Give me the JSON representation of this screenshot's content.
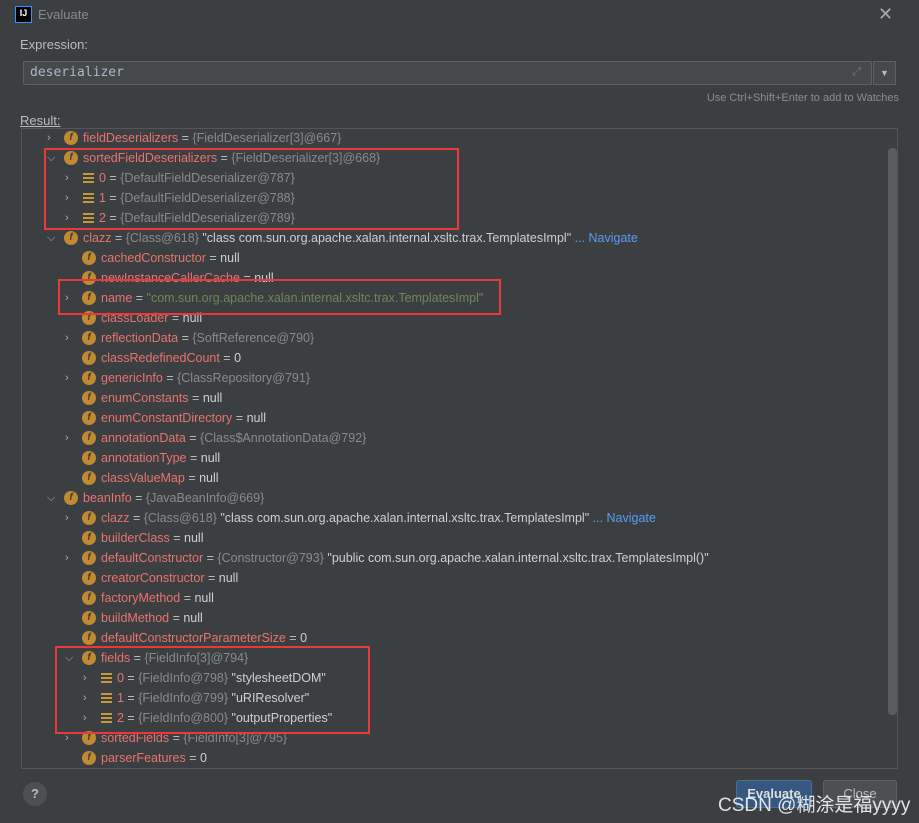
{
  "window": {
    "title": "Evaluate",
    "logo": "IJ",
    "close_icon": "close-icon"
  },
  "expression": {
    "label": "Expression:",
    "value": "deserializer",
    "hint": "Use Ctrl+Shift+Enter to add to Watches"
  },
  "result": {
    "label": "Result:"
  },
  "rows": [
    {
      "level": 0,
      "exp": "collapsed",
      "icon": "field",
      "name": "fieldDeserializers",
      "type": "{FieldDeserializer[3]@667}"
    },
    {
      "level": 0,
      "exp": "expanded",
      "icon": "field",
      "name": "sortedFieldDeserializers",
      "type": "{FieldDeserializer[3]@668}"
    },
    {
      "level": 1,
      "exp": "collapsed",
      "icon": "array",
      "name": "0",
      "type": "{DefaultFieldDeserializer@787}"
    },
    {
      "level": 1,
      "exp": "collapsed",
      "icon": "array",
      "name": "1",
      "type": "{DefaultFieldDeserializer@788}"
    },
    {
      "level": 1,
      "exp": "collapsed",
      "icon": "array",
      "name": "2",
      "type": "{DefaultFieldDeserializer@789}"
    },
    {
      "level": 0,
      "exp": "expanded",
      "icon": "field",
      "name": "clazz",
      "type": "{Class@618}",
      "str": "\"class com.sun.org.apache.xalan.internal.xsltc.trax.TemplatesImpl\"",
      "nav": "... Navigate"
    },
    {
      "level": 1,
      "exp": "none",
      "icon": "field",
      "name": "cachedConstructor",
      "plain": "null"
    },
    {
      "level": 1,
      "exp": "none",
      "icon": "field",
      "name": "newInstanceCallerCache",
      "plain": "null"
    },
    {
      "level": 1,
      "exp": "collapsed",
      "icon": "field",
      "name": "name",
      "gstr": "\"com.sun.org.apache.xalan.internal.xsltc.trax.TemplatesImpl\""
    },
    {
      "level": 1,
      "exp": "none",
      "icon": "field",
      "name": "classLoader",
      "plain": "null"
    },
    {
      "level": 1,
      "exp": "collapsed",
      "icon": "field",
      "name": "reflectionData",
      "type": "{SoftReference@790}"
    },
    {
      "level": 1,
      "exp": "none",
      "icon": "field",
      "name": "classRedefinedCount",
      "plain": "0"
    },
    {
      "level": 1,
      "exp": "collapsed",
      "icon": "field",
      "name": "genericInfo",
      "type": "{ClassRepository@791}"
    },
    {
      "level": 1,
      "exp": "none",
      "icon": "field",
      "name": "enumConstants",
      "plain": "null"
    },
    {
      "level": 1,
      "exp": "none",
      "icon": "field",
      "name": "enumConstantDirectory",
      "plain": "null"
    },
    {
      "level": 1,
      "exp": "collapsed",
      "icon": "field",
      "name": "annotationData",
      "type": "{Class$AnnotationData@792}"
    },
    {
      "level": 1,
      "exp": "none",
      "icon": "field",
      "name": "annotationType",
      "plain": "null"
    },
    {
      "level": 1,
      "exp": "none",
      "icon": "field",
      "name": "classValueMap",
      "plain": "null"
    },
    {
      "level": 0,
      "exp": "expanded",
      "icon": "field",
      "name": "beanInfo",
      "type": "{JavaBeanInfo@669}"
    },
    {
      "level": 1,
      "exp": "collapsed",
      "icon": "field",
      "name": "clazz",
      "type": "{Class@618}",
      "str": "\"class com.sun.org.apache.xalan.internal.xsltc.trax.TemplatesImpl\"",
      "nav": "... Navigate"
    },
    {
      "level": 1,
      "exp": "none",
      "icon": "field",
      "name": "builderClass",
      "plain": "null"
    },
    {
      "level": 1,
      "exp": "collapsed",
      "icon": "field",
      "name": "defaultConstructor",
      "type": "{Constructor@793}",
      "str": "\"public com.sun.org.apache.xalan.internal.xsltc.trax.TemplatesImpl()\""
    },
    {
      "level": 1,
      "exp": "none",
      "icon": "field",
      "name": "creatorConstructor",
      "plain": "null"
    },
    {
      "level": 1,
      "exp": "none",
      "icon": "field",
      "name": "factoryMethod",
      "plain": "null"
    },
    {
      "level": 1,
      "exp": "none",
      "icon": "field",
      "name": "buildMethod",
      "plain": "null"
    },
    {
      "level": 1,
      "exp": "none",
      "icon": "field",
      "name": "defaultConstructorParameterSize",
      "plain": "0"
    },
    {
      "level": 1,
      "exp": "expanded",
      "icon": "field",
      "name": "fields",
      "type": "{FieldInfo[3]@794}"
    },
    {
      "level": 2,
      "exp": "collapsed",
      "icon": "array",
      "name": "0",
      "type": "{FieldInfo@798}",
      "str": "\"stylesheetDOM\""
    },
    {
      "level": 2,
      "exp": "collapsed",
      "icon": "array",
      "name": "1",
      "type": "{FieldInfo@799}",
      "str": "\"uRIResolver\""
    },
    {
      "level": 2,
      "exp": "collapsed",
      "icon": "array",
      "name": "2",
      "type": "{FieldInfo@800}",
      "str": "\"outputProperties\""
    },
    {
      "level": 1,
      "exp": "collapsed",
      "icon": "field",
      "name": "sortedFields",
      "type": "{FieldInfo[3]@795}"
    },
    {
      "level": 1,
      "exp": "none",
      "icon": "field",
      "name": "parserFeatures",
      "plain": "0"
    }
  ],
  "buttons": {
    "help": "?",
    "evaluate": "Evaluate",
    "close": "Close"
  },
  "watermark": "CSDN @糊涂是福yyyy"
}
